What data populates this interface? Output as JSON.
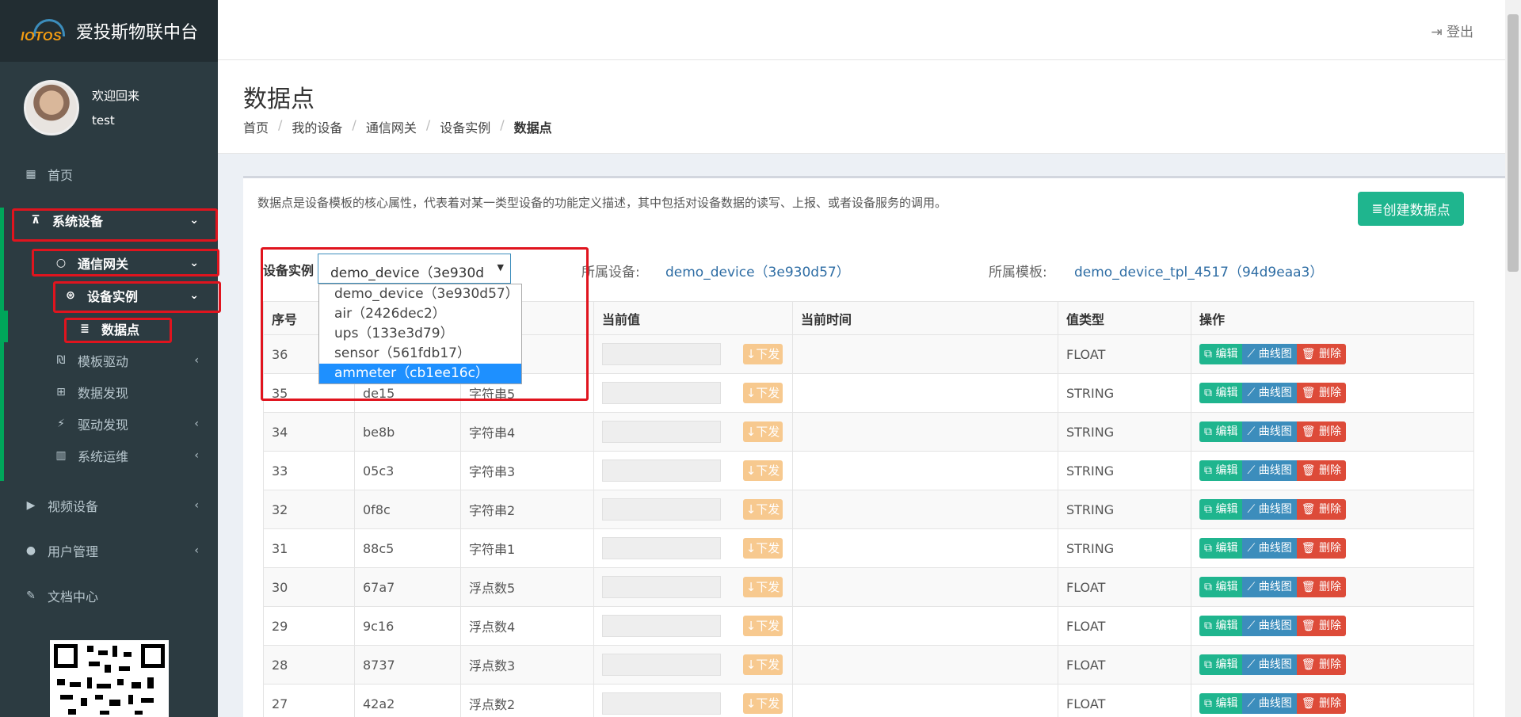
{
  "app": {
    "logo_text": "IOTOS",
    "title": "爱投斯物联中台"
  },
  "user": {
    "welcome": "欢迎回来",
    "name": "test"
  },
  "sidebar": {
    "home": "首页",
    "system_devices": "系统设备",
    "gateway": "通信网关",
    "device_instance": "设备实例",
    "data_points": "数据点",
    "template_driver": "模板驱动",
    "data_discovery": "数据发现",
    "driver_discovery": "驱动发现",
    "system_ops": "系统运维",
    "video_devices": "视频设备",
    "user_mgmt": "用户管理",
    "docs": "文档中心"
  },
  "header": {
    "logout": "登出"
  },
  "page": {
    "title": "数据点",
    "breadcrumb": [
      "首页",
      "我的设备",
      "通信网关",
      "设备实例",
      "数据点"
    ],
    "description": "数据点是设备模板的核心属性，代表着对某一类型设备的功能定义描述，其中包括对设备数据的读写、上报、或者设备服务的调用。",
    "create_button": "创建数据点"
  },
  "filter": {
    "label": "设备实例",
    "selected": "demo_device（3e930d",
    "options": [
      "demo_device（3e930d57）",
      "air（2426dec2）",
      "ups（133e3d79）",
      "sensor（561fdb17）",
      "ammeter（cb1ee16c）"
    ],
    "highlighted_index": 4,
    "device_label": "所属设备:",
    "device_value": "demo_device（3e930d57）",
    "template_label": "所属模板:",
    "template_value": "demo_device_tpl_4517（94d9eaa3）"
  },
  "table": {
    "headers": [
      "序号",
      "",
      "",
      "当前值",
      "当前时间",
      "值类型",
      "操作"
    ],
    "send_label": "下发",
    "ops": {
      "edit": "编辑",
      "curve": "曲线图",
      "delete": "删除"
    },
    "rows": [
      {
        "no": "36",
        "id": "",
        "name": "",
        "type": "FLOAT"
      },
      {
        "no": "35",
        "id": "de15",
        "name": "字符串5",
        "type": "STRING"
      },
      {
        "no": "34",
        "id": "be8b",
        "name": "字符串4",
        "type": "STRING"
      },
      {
        "no": "33",
        "id": "05c3",
        "name": "字符串3",
        "type": "STRING"
      },
      {
        "no": "32",
        "id": "0f8c",
        "name": "字符串2",
        "type": "STRING"
      },
      {
        "no": "31",
        "id": "88c5",
        "name": "字符串1",
        "type": "STRING"
      },
      {
        "no": "30",
        "id": "67a7",
        "name": "浮点数5",
        "type": "FLOAT"
      },
      {
        "no": "29",
        "id": "9c16",
        "name": "浮点数4",
        "type": "FLOAT"
      },
      {
        "no": "28",
        "id": "8737",
        "name": "浮点数3",
        "type": "FLOAT"
      },
      {
        "no": "27",
        "id": "42a2",
        "name": "浮点数2",
        "type": "FLOAT"
      }
    ]
  }
}
